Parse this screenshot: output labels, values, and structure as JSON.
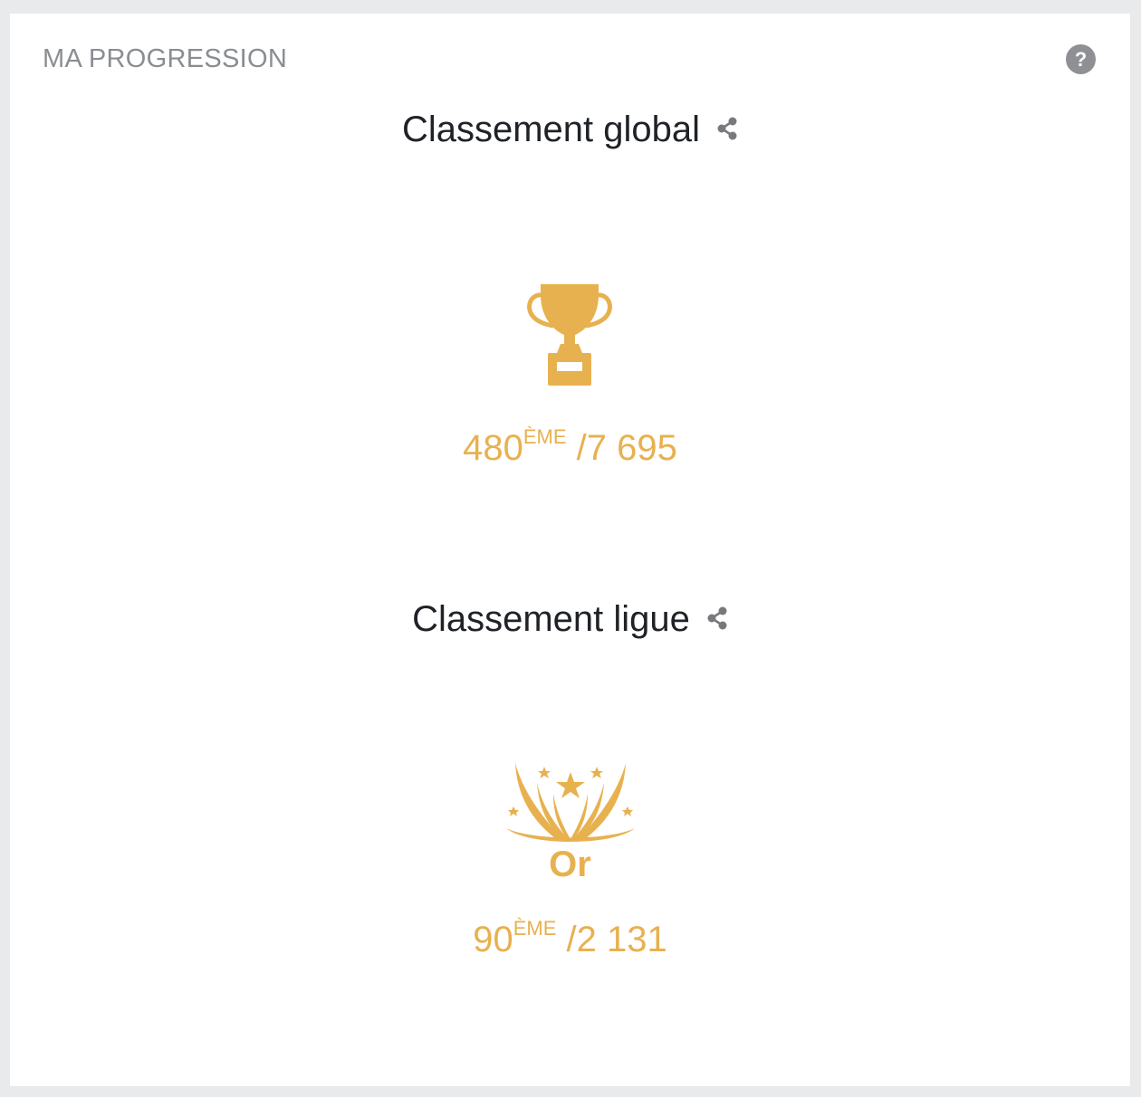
{
  "header": {
    "title": "MA PROGRESSION",
    "help_label": "?"
  },
  "global_ranking": {
    "title": "Classement global",
    "icon": "trophy-icon",
    "rank": "480",
    "rank_suffix": "ÈME",
    "total": "/7 695"
  },
  "league_ranking": {
    "title": "Classement ligue",
    "icon": "gold-league-badge-icon",
    "league_name": "Or",
    "rank": "90",
    "rank_suffix": "ÈME",
    "total": "/2 131"
  },
  "colors": {
    "accent_gold": "#e8b14f",
    "title_gray": "#8a8d92",
    "heading_dark": "#1f2227",
    "icon_gray": "#77797d",
    "background": "#e9eaec"
  }
}
